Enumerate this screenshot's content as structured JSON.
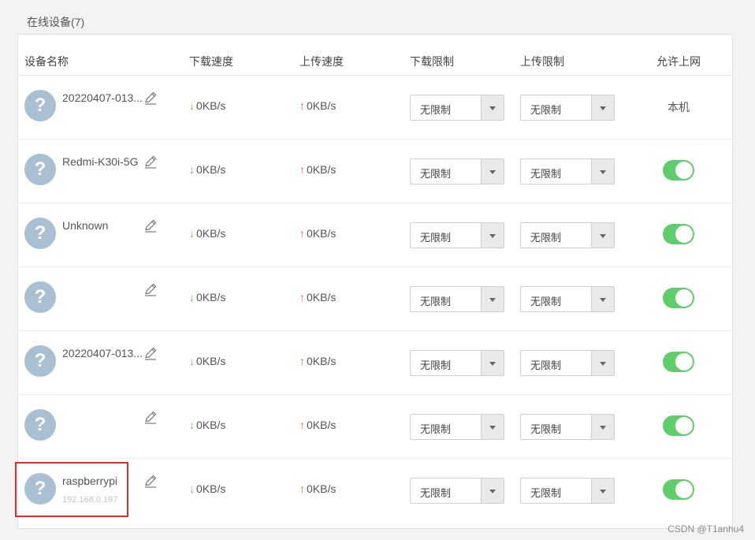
{
  "section_title": "在线设备(7)",
  "columns": {
    "name": "设备名称",
    "down_speed": "下载速度",
    "up_speed": "上传速度",
    "down_limit": "下载限制",
    "up_limit": "上传限制",
    "allow": "允许上网"
  },
  "arrows": {
    "down": "↓",
    "up": "↑"
  },
  "devices": [
    {
      "name": "20220407-013...",
      "ip": "",
      "down": "0KB/s",
      "up": "0KB/s",
      "down_limit": "无限制",
      "up_limit": "无限制",
      "allow_text": "本机"
    },
    {
      "name": "Redmi-K30i-5G",
      "ip": "",
      "down": "0KB/s",
      "up": "0KB/s",
      "down_limit": "无限制",
      "up_limit": "无限制",
      "allowed": true
    },
    {
      "name": "Unknown",
      "ip": "",
      "down": "0KB/s",
      "up": "0KB/s",
      "down_limit": "无限制",
      "up_limit": "无限制",
      "allowed": true
    },
    {
      "name": "",
      "ip": "",
      "down": "0KB/s",
      "up": "0KB/s",
      "down_limit": "无限制",
      "up_limit": "无限制",
      "allowed": true
    },
    {
      "name": "20220407-013...",
      "ip": "",
      "down": "0KB/s",
      "up": "0KB/s",
      "down_limit": "无限制",
      "up_limit": "无限制",
      "allowed": true
    },
    {
      "name": "",
      "ip": "",
      "down": "0KB/s",
      "up": "0KB/s",
      "down_limit": "无限制",
      "up_limit": "无限制",
      "allowed": true
    },
    {
      "name": "raspberrypi",
      "ip": "192.168.0.197",
      "down": "0KB/s",
      "up": "0KB/s",
      "down_limit": "无限制",
      "up_limit": "无限制",
      "allowed": true
    }
  ],
  "avatar_glyph": "?",
  "watermark": "CSDN @T1anhu4",
  "colors": {
    "toggle_on": "#5fce6a",
    "arrow_down": "#6cbf47",
    "arrow_up": "#e0664e",
    "highlight_border": "#d5312d",
    "avatar_bg": "#a9bfd2"
  }
}
